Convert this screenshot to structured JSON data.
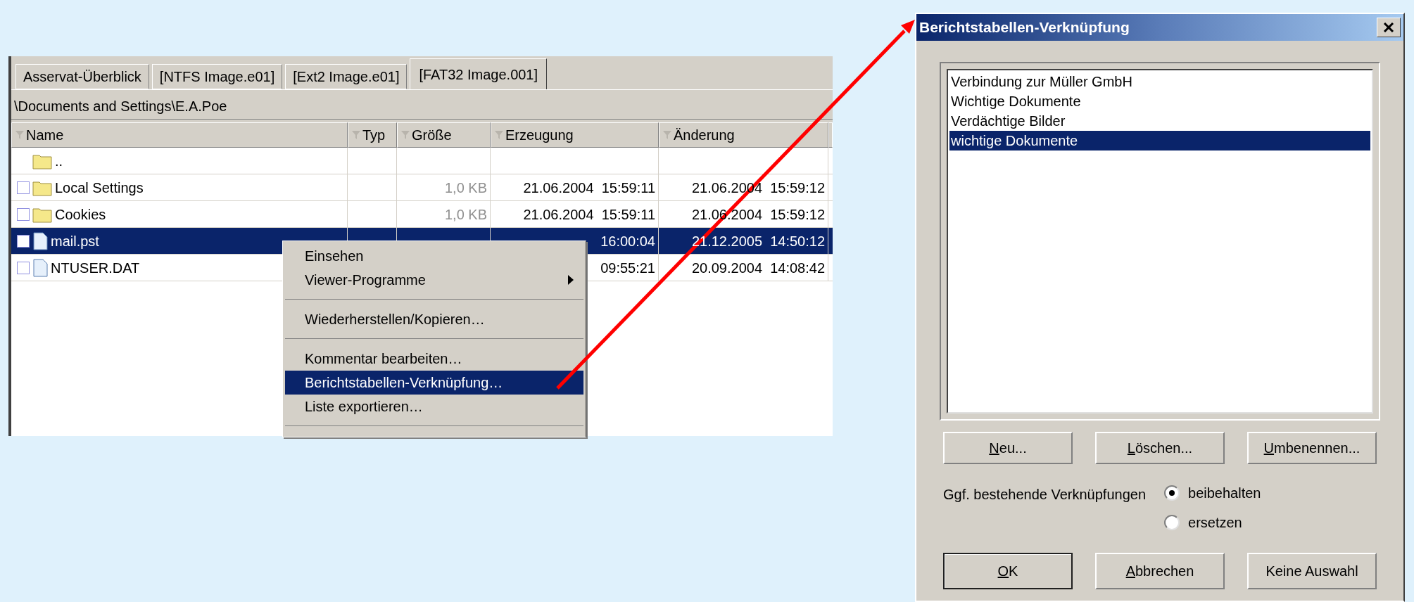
{
  "explorer": {
    "tabs": [
      {
        "label": "Asservat-Überblick",
        "selected": false
      },
      {
        "label": "[NTFS Image.e01]",
        "selected": false
      },
      {
        "label": "[Ext2 Image.e01]",
        "selected": false
      },
      {
        "label": "[FAT32 Image.001]",
        "selected": true
      }
    ],
    "path": "\\Documents and Settings\\E.A.Poe",
    "columns": [
      "Name",
      "Typ",
      "Größe",
      "Erzeugung",
      "Änderung"
    ],
    "rows": [
      {
        "kind": "parent",
        "name": "..",
        "selected": false
      },
      {
        "kind": "folder",
        "name": "Local Settings",
        "checked": false,
        "selected": false,
        "size": "1,0 KB",
        "created": "21.06.2004  15:59:11",
        "modified": "21.06.2004  15:59:12"
      },
      {
        "kind": "folder",
        "name": "Cookies",
        "checked": false,
        "selected": false,
        "size": "1,0 KB",
        "created": "21.06.2004  15:59:11",
        "modified": "21.06.2004  15:59:12"
      },
      {
        "kind": "file",
        "name": "mail.pst",
        "checked": false,
        "selected": true,
        "created": "16:00:04",
        "modified": "21.12.2005  14:50:12"
      },
      {
        "kind": "file",
        "name": "NTUSER.DAT",
        "checked": false,
        "selected": false,
        "created": "09:55:21",
        "modified": "20.09.2004  14:08:42"
      }
    ],
    "context_menu": [
      {
        "kind": "item",
        "label": "Einsehen",
        "selected": false
      },
      {
        "kind": "submenu",
        "label": "Viewer-Programme",
        "selected": false
      },
      {
        "kind": "separator",
        "selected": false
      },
      {
        "kind": "item",
        "label": "Wiederherstellen/Kopieren…",
        "selected": false
      },
      {
        "kind": "separator",
        "selected": false
      },
      {
        "kind": "item",
        "label": "Kommentar bearbeiten…",
        "selected": false
      },
      {
        "kind": "item",
        "label": "Berichtstabellen-Verknüpfung…",
        "selected": true
      },
      {
        "kind": "item",
        "label": "Liste exportieren…",
        "selected": false
      },
      {
        "kind": "separator",
        "selected": false
      }
    ]
  },
  "dialog": {
    "title": "Berichtstabellen-Verknüpfung",
    "tables": [
      {
        "label": "Verbindung zur Müller GmbH",
        "selected": false
      },
      {
        "label": "Wichtige Dokumente",
        "selected": false
      },
      {
        "label": "Verdächtige Bilder",
        "selected": false
      },
      {
        "label": "wichtige Dokumente",
        "selected": true
      }
    ],
    "actions": [
      {
        "label": "Neu...",
        "mnemonic_first": true
      },
      {
        "label": "Löschen...",
        "mnemonic_first": true
      },
      {
        "label": "Umbenennen...",
        "mnemonic_first": true
      }
    ],
    "option_label": "Ggf. bestehende Verknüpfungen",
    "options": [
      {
        "label": "beibehalten",
        "selected": true
      },
      {
        "label": "ersetzen",
        "selected": false
      }
    ],
    "buttons": [
      {
        "label": "OK",
        "mnemonic_first": true,
        "default": true
      },
      {
        "label": "Abbrechen",
        "mnemonic_first": true,
        "default": false
      },
      {
        "label": "Keine Auswahl",
        "mnemonic_first": false,
        "default": false
      }
    ]
  }
}
